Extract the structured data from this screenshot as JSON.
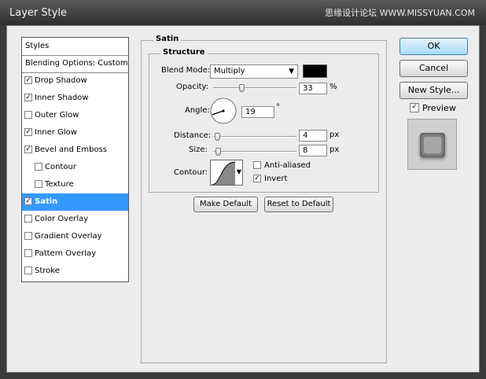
{
  "window": {
    "title": "Layer Style",
    "watermark": "思缘设计论坛 WWW.MISSYUAN.COM"
  },
  "sidebar": {
    "header": "Styles",
    "blending": "Blending Options: Custom",
    "items": [
      {
        "label": "Drop Shadow",
        "checked": true,
        "indent": false,
        "selected": false
      },
      {
        "label": "Inner Shadow",
        "checked": true,
        "indent": false,
        "selected": false
      },
      {
        "label": "Outer Glow",
        "checked": false,
        "indent": false,
        "selected": false
      },
      {
        "label": "Inner Glow",
        "checked": true,
        "indent": false,
        "selected": false
      },
      {
        "label": "Bevel and Emboss",
        "checked": true,
        "indent": false,
        "selected": false
      },
      {
        "label": "Contour",
        "checked": false,
        "indent": true,
        "selected": false
      },
      {
        "label": "Texture",
        "checked": false,
        "indent": true,
        "selected": false
      },
      {
        "label": "Satin",
        "checked": true,
        "indent": false,
        "selected": true
      },
      {
        "label": "Color Overlay",
        "checked": false,
        "indent": false,
        "selected": false
      },
      {
        "label": "Gradient Overlay",
        "checked": false,
        "indent": false,
        "selected": false
      },
      {
        "label": "Pattern Overlay",
        "checked": false,
        "indent": false,
        "selected": false
      },
      {
        "label": "Stroke",
        "checked": false,
        "indent": false,
        "selected": false
      }
    ]
  },
  "satin": {
    "title": "Satin",
    "structure_title": "Structure",
    "blend_mode_label": "Blend Mode:",
    "blend_mode_value": "Multiply",
    "blend_color": "#000000",
    "opacity_label": "Opacity:",
    "opacity_value": "33",
    "opacity_unit": "%",
    "opacity_fraction": 0.33,
    "angle_label": "Angle:",
    "angle_value": "19",
    "angle_unit": "°",
    "distance_label": "Distance:",
    "distance_value": "4",
    "distance_unit": "px",
    "distance_fraction": 0.02,
    "size_label": "Size:",
    "size_value": "8",
    "size_unit": "px",
    "size_fraction": 0.03,
    "contour_label": "Contour:",
    "anti_aliased_label": "Anti-aliased",
    "anti_aliased_checked": false,
    "invert_label": "Invert",
    "invert_checked": true,
    "make_default": "Make Default",
    "reset_default": "Reset to Default"
  },
  "buttons": {
    "ok": "OK",
    "cancel": "Cancel",
    "new_style": "New Style..."
  },
  "preview": {
    "label": "Preview",
    "checked": true
  }
}
